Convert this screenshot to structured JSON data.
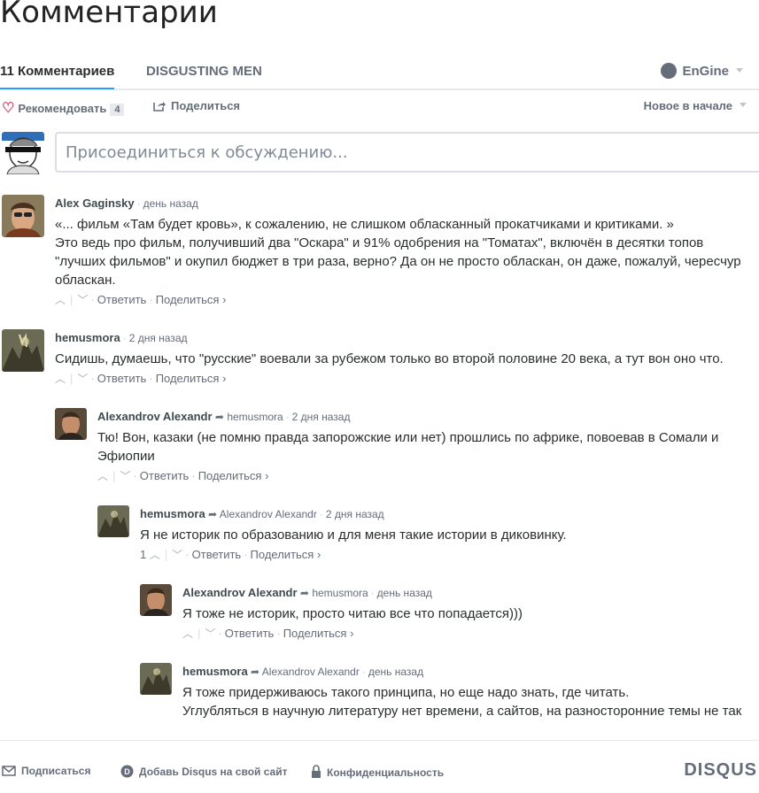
{
  "page": {
    "title": "Комментарии"
  },
  "nav": {
    "comments_tab": "11 Комментариев",
    "forum_tab": "DISGUSTING MEN",
    "user": "EnGine"
  },
  "toolbar": {
    "recommend": "Рекомендовать",
    "recommend_count": "4",
    "share": "Поделиться",
    "sort": "Новое в начале"
  },
  "compose": {
    "placeholder": "Присоединиться к обсуждению..."
  },
  "labels": {
    "reply": "Ответить",
    "share": "Поделиться ›",
    "dot": "·"
  },
  "comments": [
    {
      "author": "Alex Gaginsky",
      "time": "день назад",
      "lines": [
        "«... фильм «Там будет кровь», к сожалению, не слишком обласканный прокатчиками и критиками. »",
        "Это ведь про фильм, получивший два \"Оскара\" и 91% одобрения на \"Томатах\", включён в десятки топов",
        "\"лучших фильмов\" и окупил бюджет в три раза, верно? Да он не просто обласкан, он даже, пожалуй, чересчур",
        "обласкан."
      ]
    },
    {
      "author": "hemusmora",
      "time": "2 дня назад",
      "lines": [
        "Сидишь, думаешь, что \"русские\" воевали за рубежом только во второй половине 20 века, а тут вон оно что."
      ]
    },
    {
      "author": "Alexandrov Alexandr",
      "reply_to": "hemusmora",
      "time": "2 дня назад",
      "lines": [
        "Тю! Вон, казаки (не помню правда запорожские или нет) прошлись по африке, повоевав в Сомали и",
        "Эфиопии"
      ]
    },
    {
      "author": "hemusmora",
      "reply_to": "Alexandrov Alexandr",
      "time": "2 дня назад",
      "votes": "1",
      "lines": [
        "Я не историк по образованию и для меня такие истории в диковинку."
      ]
    },
    {
      "author": "Alexandrov Alexandr",
      "reply_to": "hemusmora",
      "time": "день назад",
      "lines": [
        "Я тоже не историк, просто читаю все что попадается)))"
      ]
    },
    {
      "author": "hemusmora",
      "reply_to": "Alexandrov Alexandr",
      "time": "день назад",
      "lines": [
        "Я тоже придерживаюсь такого принципа, но еще надо знать, где читать.",
        "Углубляться в научную литературу нет времени, а сайтов, на разносторонние темы не так"
      ]
    }
  ],
  "footer": {
    "subscribe": "Подписаться",
    "add_disqus": "Добавь Disqus на свой сайт",
    "privacy": "Конфиденциальность",
    "brand": "DISQUS"
  }
}
